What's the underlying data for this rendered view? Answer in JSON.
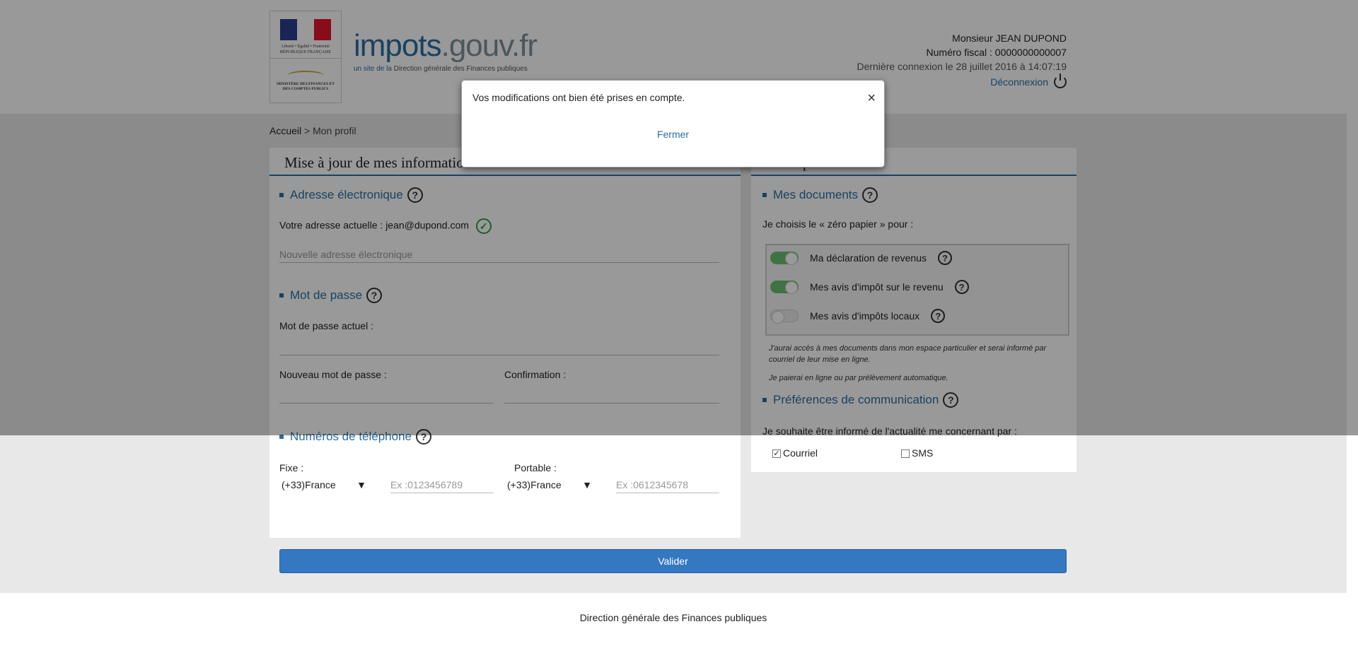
{
  "header": {
    "rf_text": "Liberté • Égalité • Fraternité RÉPUBLIQUE FRANÇAISE",
    "ministry_text": "MINISTÈRE DES FINANCES ET DES COMPTES PUBLICS",
    "brand_main": "impots",
    "brand_dot": ".gouv.fr",
    "brand_sub_prefix": "un site de la",
    "brand_sub_name": "Direction générale des Finances publiques",
    "user_name": "Monsieur JEAN DUPOND",
    "fiscal_number": "Numéro fiscal : 0000000000007",
    "last_login": "Dernière connexion le 28 juillet 2016 à 14:07:19",
    "logout_label": "Déconnexion"
  },
  "breadcrumb": {
    "home": "Accueil",
    "separator": ">",
    "current": "Mon profil"
  },
  "left_panel": {
    "title": "Mise à jour de mes informations",
    "email_section": "Adresse électronique",
    "current_email_label": "Votre adresse actuelle : jean@dupond.com",
    "new_email_placeholder": "Nouvelle adresse électronique",
    "password_section": "Mot de passe",
    "current_password_label": "Mot de passe actuel :",
    "new_password_label": "Nouveau mot de passe :",
    "confirm_label": "Confirmation :",
    "phone_section": "Numéros de téléphone",
    "fixe_label": "Fixe :",
    "fixe_country": "(+33)France",
    "fixe_placeholder": "Ex :0123456789",
    "portable_label": "Portable :",
    "portable_country": "(+33)France",
    "portable_placeholder": "Ex :0612345678"
  },
  "right_panel": {
    "title": "Mes options",
    "docs_section": "Mes documents",
    "zero_paper": "Je choisis le « zéro papier » pour :",
    "toggles": [
      {
        "label": "Ma déclaration de revenus",
        "on": true
      },
      {
        "label": "Mes avis d'impôt sur le revenu",
        "on": true
      },
      {
        "label": "Mes avis d'impôts locaux",
        "on": false
      }
    ],
    "note1": "J'aurai accès à mes documents dans mon espace particulier et serai informé par courriel de leur mise en ligne.",
    "note2": "Je paierai en ligne ou par prélèvement automatique.",
    "comm_section": "Préférences de communication",
    "comm_text": "Je souhaite être informé de l'actualité me concernant par :",
    "courriel_label": "Courriel",
    "courriel_checked": true,
    "sms_label": "SMS",
    "sms_checked": false
  },
  "valider_label": "Valider",
  "footer": "Direction générale des Finances publiques",
  "modal": {
    "message": "Vos modifications ont bien été prises en compte.",
    "close_glyph": "×",
    "button": "Fermer"
  }
}
